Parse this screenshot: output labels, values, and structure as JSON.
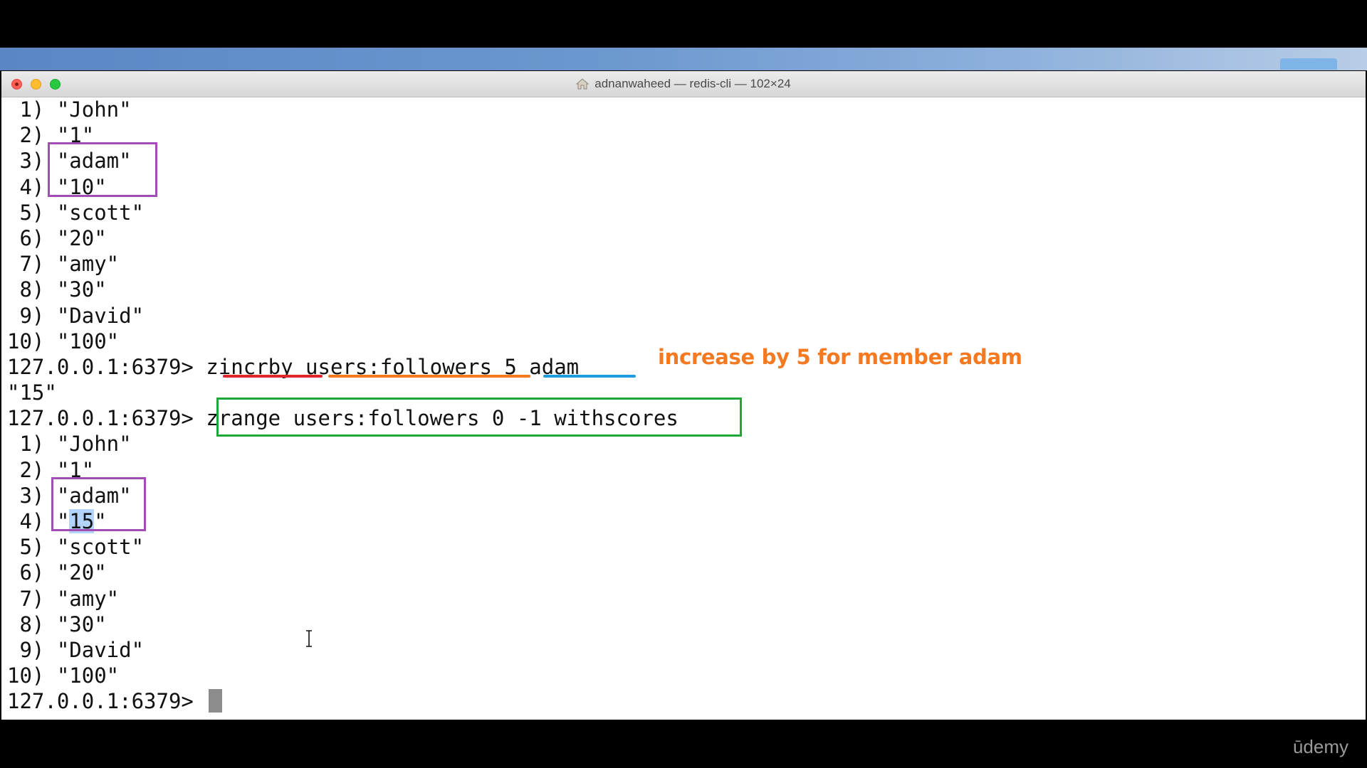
{
  "window": {
    "title": "adnanwaheed — redis-cli — 102×24"
  },
  "terminal": {
    "lines": [
      " 1) \"John\"",
      " 2) \"1\"",
      " 3) \"adam\"",
      " 4) \"10\"",
      " 5) \"scott\"",
      " 6) \"20\"",
      " 7) \"amy\"",
      " 8) \"30\"",
      " 9) \"David\"",
      "10) \"100\"",
      "127.0.0.1:6379> zincrby users:followers 5 adam",
      "\"15\"",
      "127.0.0.1:6379> zrange users:followers 0 -1 withscores",
      " 1) \"John\"",
      " 2) \"1\"",
      " 3) \"adam\"",
      " 4) \"15\"",
      " 5) \"scott\"",
      " 6) \"20\"",
      " 7) \"amy\"",
      " 8) \"30\"",
      " 9) \"David\"",
      "10) \"100\"",
      "127.0.0.1:6379> "
    ],
    "selected": {
      "prefix": " 4) \"",
      "text": "15",
      "suffix": "\""
    }
  },
  "annotation": {
    "text": "increase by 5 for member adam"
  },
  "colors": {
    "purple_box": "#a24db6",
    "green_box": "#1fa83a",
    "underline_command": "#e0252b",
    "underline_key": "#f47920",
    "underline_args": "#1e9be0",
    "annotation": "#f47920"
  },
  "watermark": {
    "text": "ūdemy"
  }
}
